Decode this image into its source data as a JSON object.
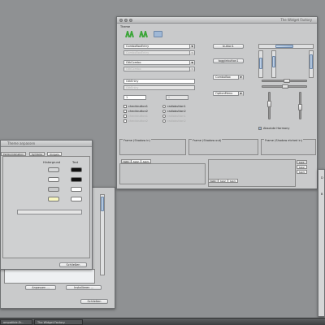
{
  "main_window": {
    "title": "The Widget Factory",
    "section": "Theme",
    "combos": [
      {
        "label": "ComboBoxEntry",
        "disabled": false
      },
      {
        "label": "ComboBoxEntry",
        "disabled": true
      },
      {
        "label": "GtkCombo",
        "disabled": false
      },
      {
        "label": "GtkCombo",
        "disabled": true
      }
    ],
    "entries": [
      {
        "label": "GtkEntry",
        "disabled": false
      },
      {
        "label": "GtkEntry",
        "disabled": true
      }
    ],
    "spin": {
      "value": "1",
      "disabled_value": "0"
    },
    "checks": [
      "checkbutton1",
      "checkbutton2",
      "checkbutton1",
      "checkbutton2"
    ],
    "radios": [
      "radiobutton1",
      "radiobutton2",
      "radiobutton1",
      "radiobutton2"
    ],
    "buttons": {
      "button1": "button1",
      "togglebutton1": "togglebutton1",
      "combobox": "ComboBox",
      "optionmenu": "OptionMenu"
    },
    "absolute_label": "Absolute Harmony",
    "frames": [
      "Frame (Shadow in)",
      "Frame (Shadow out)",
      "Frame (Shadow etched in)"
    ],
    "tabs_a": [
      "tab1",
      "tab2",
      "tab3"
    ],
    "tabs_b": [
      "tab1",
      "tab2",
      "tab3"
    ],
    "tabs_c": [
      "tab1",
      "tab2",
      "tab3"
    ]
  },
  "theme_dialog": {
    "title": "Theme anpassen",
    "tabs": [
      "Farbkombination",
      "Symbole",
      "Widgets"
    ],
    "col_background": "Hintergrund",
    "col_text": "Text",
    "close_label": "Schließen"
  },
  "back_window": {
    "buttons": [
      "Anpassen ...",
      "Installieren ..."
    ],
    "close_label": "Schließen"
  },
  "right_window": {
    "labels": [
      "D",
      "B"
    ]
  },
  "taskbar": {
    "items": [
      "ompatible.Er...",
      "The Widget Factory"
    ]
  },
  "colors": {
    "desktop": "#8f9193",
    "window": "#c9cacb",
    "accent": "#9fb8d6",
    "toolbar_green": "#3da63a"
  }
}
